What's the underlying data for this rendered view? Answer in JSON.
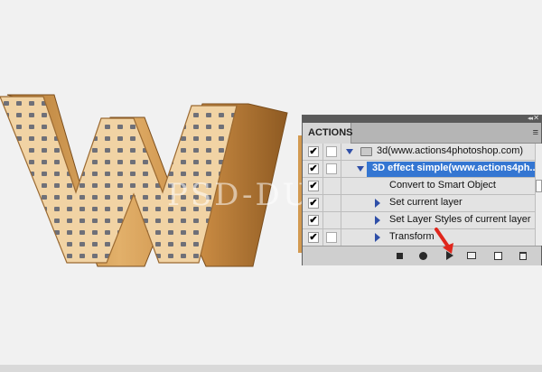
{
  "panel": {
    "tab_label": "ACTIONS",
    "collapse_glyph": "◂◂",
    "close_glyph": "✕",
    "menu_glyph": "≡",
    "rows": [
      {
        "checked": true,
        "label": "3d(www.actions4photoshop.com)",
        "type": "set",
        "expanded": true
      },
      {
        "checked": true,
        "label": "3D effect simple(www.actions4ph...",
        "type": "action",
        "expanded": true,
        "selected": true
      },
      {
        "checked": true,
        "label": "Convert to Smart Object",
        "type": "step"
      },
      {
        "checked": true,
        "label": "Set current layer",
        "type": "step"
      },
      {
        "checked": true,
        "label": "Set Layer Styles of current layer",
        "type": "step"
      },
      {
        "checked": true,
        "label": "Transform",
        "type": "step"
      }
    ],
    "footer_buttons": [
      "stop-icon",
      "record-icon",
      "play-icon",
      "new-set-icon",
      "new-action-icon",
      "delete-icon"
    ]
  },
  "artwork": {
    "watermark": "PSD-DUDE.COM",
    "letter": "W"
  },
  "colors": {
    "selection": "#3476d2",
    "wood": "#d9a45a",
    "arrow": "#e0261c"
  }
}
